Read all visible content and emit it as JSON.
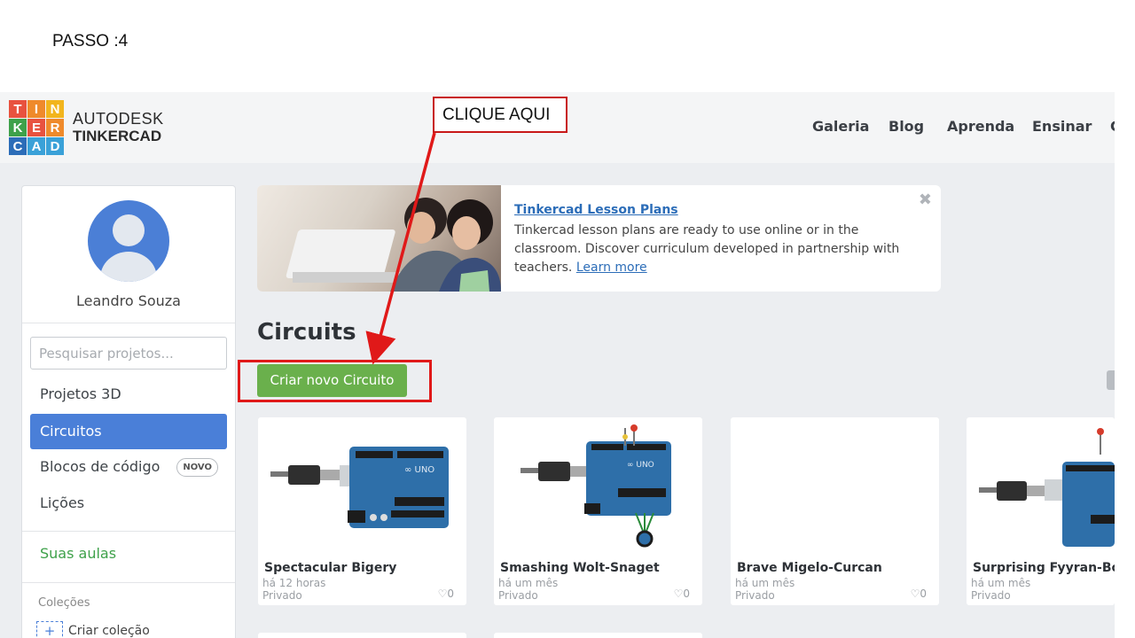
{
  "slide": {
    "step_title": "PASSO :4"
  },
  "annotation": {
    "label": "CLIQUE AQUI",
    "color": "#e01919"
  },
  "logo": {
    "letters": [
      "T",
      "I",
      "N",
      "K",
      "E",
      "R",
      "C",
      "A",
      "D"
    ],
    "colors": [
      "#e8523f",
      "#ef8a2b",
      "#f2b51d",
      "#3ea14a",
      "#e8523f",
      "#ef8a2b",
      "#2c6db8",
      "#3aa1d8",
      "#3aa1d8"
    ]
  },
  "brand": {
    "line1": "AUTODESK",
    "line2": "TINKERCAD"
  },
  "nav": {
    "items": [
      "Galeria",
      "Blog",
      "Aprenda",
      "Ensinar"
    ],
    "truncated": "C"
  },
  "sidebar": {
    "username": "Leandro Souza",
    "search_placeholder": "Pesquisar projetos...",
    "items": [
      {
        "label": "Projetos 3D"
      },
      {
        "label": "Circuitos",
        "active": true
      },
      {
        "label": "Blocos de código",
        "badge": "NOVO"
      },
      {
        "label": "Lições"
      }
    ],
    "classes_label": "Suas aulas",
    "collections_label": "Coleções",
    "create_collection_label": "Criar coleção"
  },
  "banner": {
    "title": "Tinkercad Lesson Plans",
    "text": "Tinkercad lesson plans are ready to use online or in the classroom. Discover curriculum developed in partnership with teachers.",
    "link": "Learn more"
  },
  "main": {
    "heading": "Circuits",
    "create_button": "Criar novo Circuito"
  },
  "cards": [
    {
      "title": "Spectacular Bigery",
      "time": "há 12 horas",
      "privacy": "Privado",
      "likes": "0",
      "thumb": "arduino-usb"
    },
    {
      "title": "Smashing Wolt-Snaget",
      "time": "há um mês",
      "privacy": "Privado",
      "likes": "0",
      "thumb": "arduino-led-pot"
    },
    {
      "title": "Brave Migelo-Curcan",
      "time": "há um mês",
      "privacy": "Privado",
      "likes": "0",
      "thumb": "empty"
    },
    {
      "title": "Surprising Fyyran-Bojo",
      "time": "há um mês",
      "privacy": "Privado",
      "likes": "",
      "thumb": "arduino-led"
    }
  ]
}
